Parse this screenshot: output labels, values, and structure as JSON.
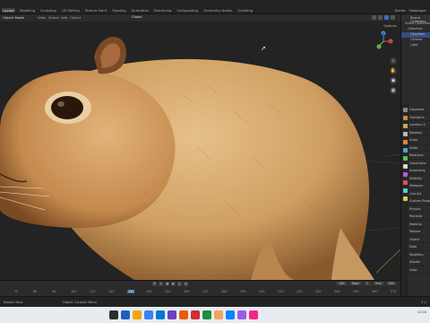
{
  "topbar": {
    "tabs": [
      "Layout",
      "Modeling",
      "Sculpting",
      "UV Editing",
      "Texture Paint",
      "Shading",
      "Animation",
      "Rendering",
      "Compositing",
      "Geometry Nodes",
      "Scripting"
    ],
    "active_tab": "Layout",
    "right_items": [
      "Scene",
      "ViewLayer"
    ]
  },
  "viewport_header": {
    "mode": "Object Mode",
    "menus": [
      "View",
      "Select",
      "Add",
      "Object"
    ],
    "transform_orientation": "Global",
    "options_label": "Options"
  },
  "navigation": {
    "gizmo_axes": [
      "X",
      "Y",
      "Z"
    ],
    "buttons": [
      "zoom-icon",
      "hand-icon",
      "camera-icon",
      "grid-icon"
    ]
  },
  "outliner": {
    "title": "Scene Collection",
    "rows": [
      "Scene Collection",
      "Collection",
      "Capybara",
      "Camera",
      "Light"
    ]
  },
  "properties": {
    "rows": [
      "Capybara",
      "Transform",
      "Location X",
      "Rotation",
      "Scale",
      "Delta",
      "Relations",
      "Collections",
      "Instancing",
      "Visibility",
      "Viewport",
      "Line Art",
      "Custom Props",
      "Physics",
      "Particles",
      "Material",
      "Texture",
      "Object",
      "Data",
      "Modifiers",
      "Shader",
      "Color"
    ],
    "icon_colors": [
      "#8a8a8a",
      "#d08a3a",
      "#cfa64a",
      "#b8b8b8",
      "#ff7a3a",
      "#4ba3d8",
      "#5bbf5b",
      "#d8d8d8",
      "#b45ad8",
      "#e05050",
      "#50d0d0",
      "#d0d050"
    ]
  },
  "timeline": {
    "current_frame": "130",
    "start_label": "Start",
    "start": "1",
    "end_label": "End",
    "end": "250",
    "ticks": [
      "70",
      "80",
      "90",
      "100",
      "110",
      "120",
      "130",
      "140",
      "150",
      "160",
      "170",
      "180",
      "190",
      "200",
      "210",
      "220",
      "230",
      "240",
      "250",
      "260",
      "270"
    ]
  },
  "statusbar": {
    "left": "Rotate View",
    "middle": "Object Context Menu",
    "right": "4.2"
  },
  "taskbar": {
    "icon_colors": [
      "#2d2d2d",
      "#1e5fbf",
      "#f0a500",
      "#3b82f6",
      "#0078d4",
      "#6a3fc1",
      "#e85d04",
      "#d32f2f",
      "#1b8e3e",
      "#f4a261",
      "#0a84ff",
      "#9b5de5",
      "#f72585"
    ],
    "tray": "12:04"
  },
  "colors": {
    "accent": "#3a6fb8",
    "viewport_bg": "#232323",
    "fur_light": "#d9b07a",
    "fur_dark": "#8a5a2e"
  }
}
